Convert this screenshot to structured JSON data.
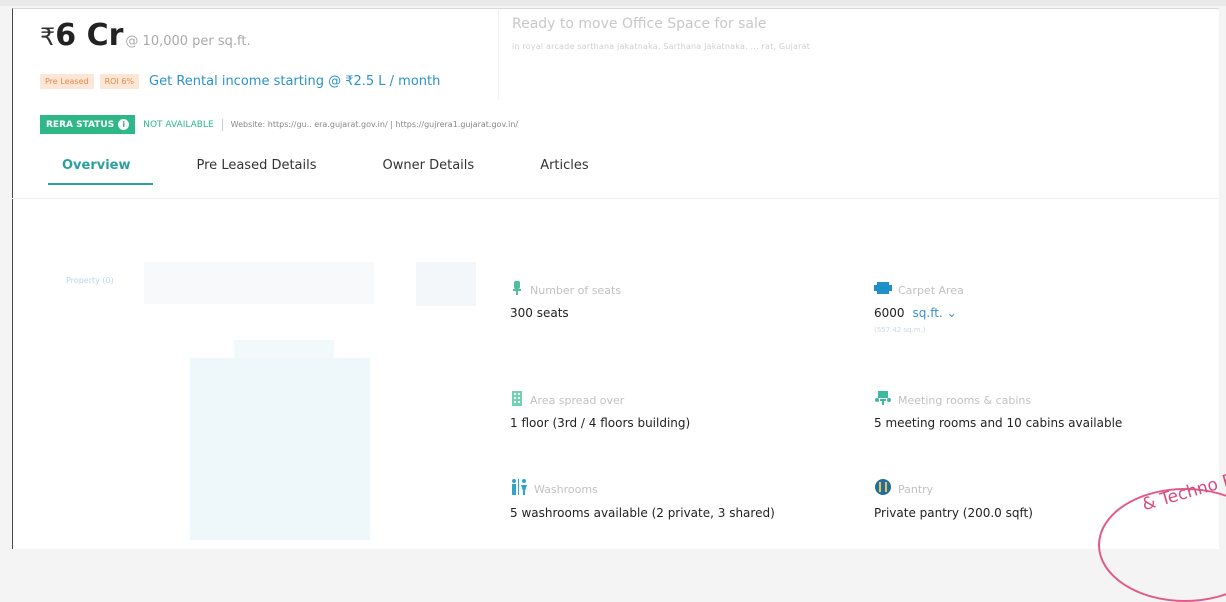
{
  "header": {
    "rupee_symbol": "₹",
    "price": "6 Cr",
    "per_sqft": "@ 10,000 per sq.ft.",
    "listing_title": "Ready to move Office Space for sale",
    "address": "in royal arcade sarthana jakatnaka, Sarthana Jakatnaka, ... rat, Gujarat"
  },
  "badges": {
    "pre_leased": "Pre Leased",
    "roi": "ROI 6%",
    "rental_link": "Get Rental income starting @ ₹2.5 L / month"
  },
  "rera": {
    "status_label": "RERA STATUS",
    "info_icon": "i",
    "status_value": "NOT AVAILABLE",
    "website": "Website: https://gu.. era.gujarat.gov.in/ | https://gujrera1.gujarat.gov.in/"
  },
  "tabs": [
    {
      "label": "Overview",
      "active": true
    },
    {
      "label": "Pre Leased Details",
      "active": false
    },
    {
      "label": "Owner Details",
      "active": false
    },
    {
      "label": "Articles",
      "active": false
    }
  ],
  "gallery": {
    "photo_label": "Property (0)"
  },
  "features": [
    {
      "icon": "seat-icon",
      "label": "Number of seats",
      "value": "300 seats"
    },
    {
      "icon": "carpet-area-icon",
      "label": "Carpet Area",
      "value": "6000",
      "unit": "sq.ft.",
      "sub": "(557.42 sq.m.)"
    },
    {
      "icon": "building-icon",
      "label": "Area spread over",
      "value": "1 floor (3rd / 4 floors building)"
    },
    {
      "icon": "meeting-room-icon",
      "label": "Meeting rooms & cabins",
      "value": "5 meeting rooms and 10 cabins available"
    },
    {
      "icon": "washroom-icon",
      "label": "Washrooms",
      "value": "5 washrooms available (2 private, 3 shared)"
    },
    {
      "icon": "pantry-icon",
      "label": "Pantry",
      "value": "Private pantry (200.0 sqft)"
    }
  ],
  "stamp": {
    "text": "& Techno En"
  },
  "colors": {
    "accent_teal": "#2ba0a0",
    "rera_green": "#2eb887",
    "link_blue": "#2b93c9",
    "badge_orange": "#e78a4a",
    "stamp_pink": "#d84b7e"
  }
}
